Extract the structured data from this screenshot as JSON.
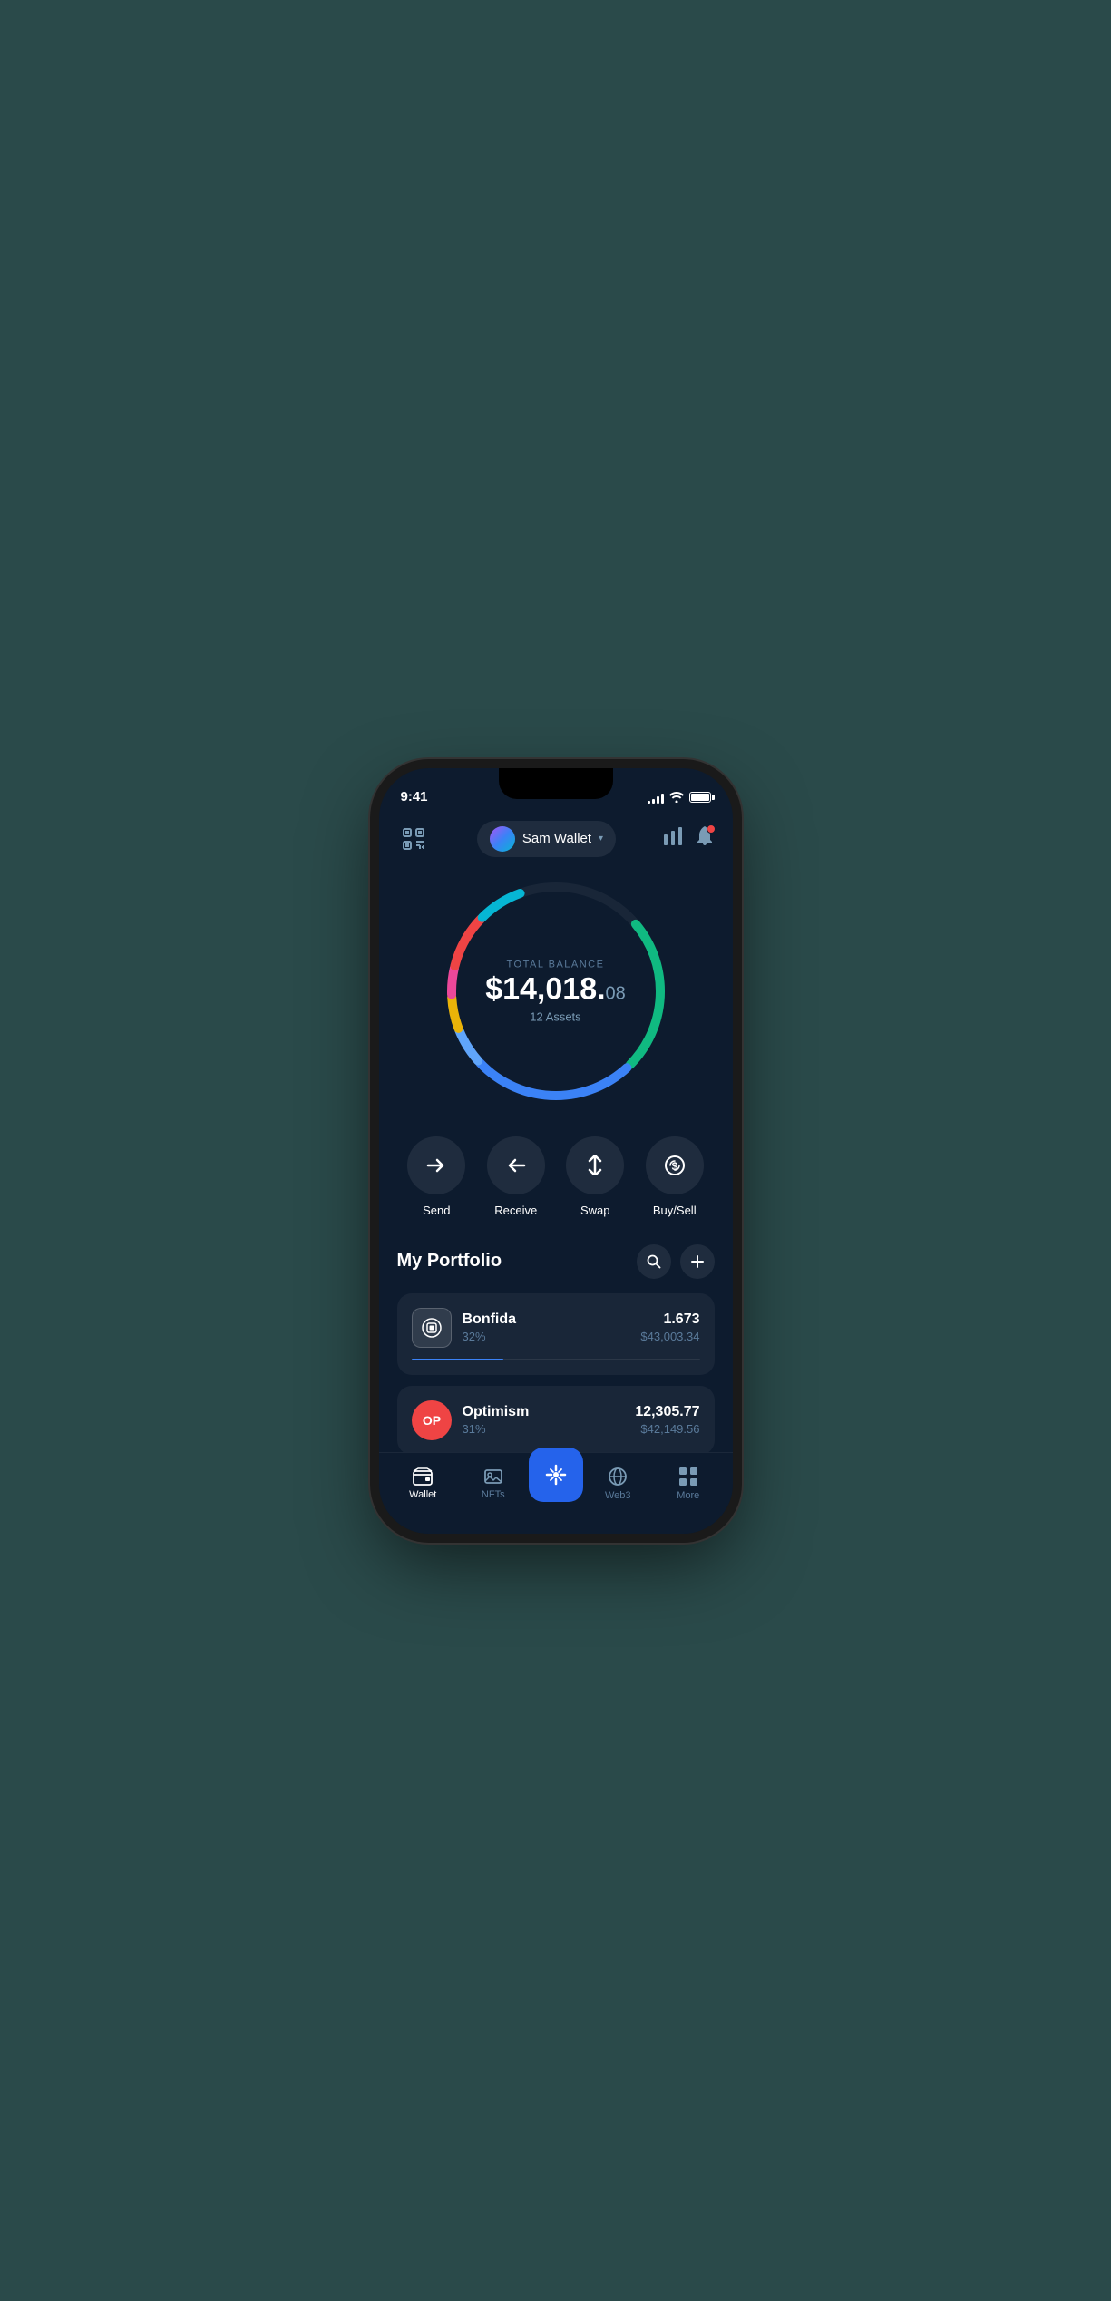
{
  "status": {
    "time": "9:41",
    "signal_bars": [
      3,
      5,
      7,
      10,
      12
    ],
    "battery_full": true
  },
  "header": {
    "scan_label": "scan",
    "wallet_name": "Sam Wallet",
    "chart_label": "charts",
    "bell_label": "notifications"
  },
  "balance": {
    "label": "TOTAL BALANCE",
    "whole": "$14,018.",
    "cents": "08",
    "assets_label": "12 Assets"
  },
  "actions": [
    {
      "id": "send",
      "label": "Send",
      "icon": "→"
    },
    {
      "id": "receive",
      "label": "Receive",
      "icon": "←"
    },
    {
      "id": "swap",
      "label": "Swap",
      "icon": "⇅"
    },
    {
      "id": "buysell",
      "label": "Buy/Sell",
      "icon": "💲"
    }
  ],
  "portfolio": {
    "title": "My Portfolio",
    "search_label": "search",
    "add_label": "add"
  },
  "assets": [
    {
      "name": "Bonfida",
      "pct": "32%",
      "amount": "1.673",
      "usd": "$43,003.34",
      "progress": 32,
      "progress_color": "#3b82f6",
      "logo_type": "bonfida"
    },
    {
      "name": "Optimism",
      "pct": "31%",
      "amount": "12,305.77",
      "usd": "$42,149.56",
      "progress": 31,
      "progress_color": "#ef4444",
      "logo_type": "optimism"
    }
  ],
  "nav": {
    "items": [
      {
        "id": "wallet",
        "label": "Wallet",
        "active": true
      },
      {
        "id": "nfts",
        "label": "NFTs",
        "active": false
      },
      {
        "id": "center",
        "label": "",
        "active": false
      },
      {
        "id": "web3",
        "label": "Web3",
        "active": false
      },
      {
        "id": "more",
        "label": "More",
        "active": false
      }
    ]
  },
  "colors": {
    "bg": "#0d1b2e",
    "accent_blue": "#2563eb",
    "text_primary": "#ffffff",
    "text_secondary": "#5a7a9a"
  }
}
